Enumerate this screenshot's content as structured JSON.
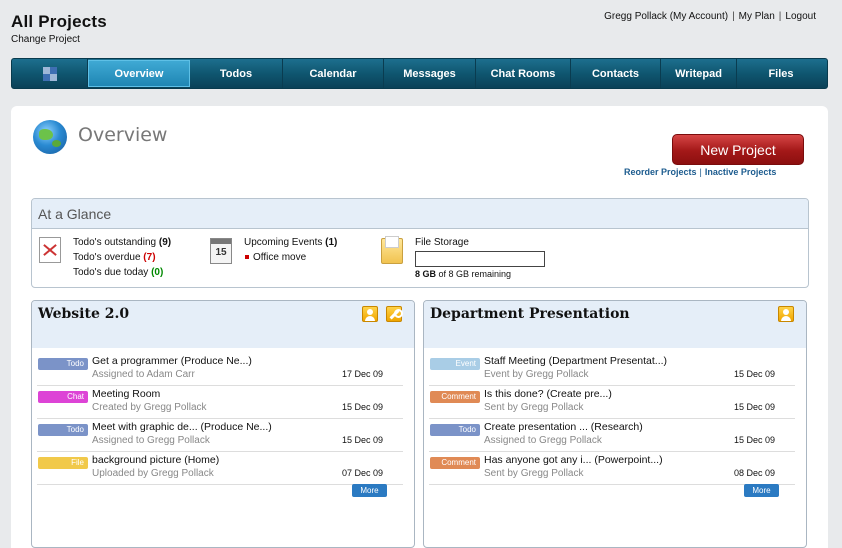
{
  "header": {
    "title": "All Projects",
    "change_project": "Change Project",
    "user_link": "Gregg Pollack (My Account)",
    "plan_link": "My Plan",
    "logout_link": "Logout",
    "separator": "|"
  },
  "nav": {
    "home_icon": "app-home-icon",
    "tabs": [
      "Overview",
      "Todos",
      "Calendar",
      "Messages",
      "Chat Rooms",
      "Contacts",
      "Writepad",
      "Files"
    ],
    "active_tab": "Overview"
  },
  "overview": {
    "icon": "globe-icon",
    "title": "Overview",
    "new_project_label": "New Project",
    "reorder_link": "Reorder Projects",
    "inactive_link": "Inactive Projects"
  },
  "glance": {
    "title": "At a Glance",
    "todos": {
      "outstanding_label": "Todo's outstanding",
      "outstanding_count": "(9)",
      "overdue_label": "Todo's overdue",
      "overdue_count": "(7)",
      "due_today_label": "Todo's due today",
      "due_today_count": "(0)"
    },
    "events": {
      "calendar_icon_text": "15",
      "label": "Upcoming Events",
      "count": "(1)",
      "item": "Office move"
    },
    "storage": {
      "label": "File Storage",
      "used": "8 GB",
      "rest": "of 8 GB remaining",
      "used_fraction": 0.0
    }
  },
  "projects": [
    {
      "title": "Website 2.0",
      "icons": [
        "person-icon",
        "wrench-icon"
      ],
      "more_label": "More",
      "items": [
        {
          "type": "Todo",
          "color": "#7b93c8",
          "title": "Get a programmer  (Produce Ne...)",
          "sub": "Assigned to Adam Carr",
          "date": "17 Dec 09"
        },
        {
          "type": "Chat",
          "color": "#dd44d6",
          "title": "Meeting Room",
          "sub": "Created by Gregg Pollack",
          "date": "15 Dec 09"
        },
        {
          "type": "Todo",
          "color": "#7b93c8",
          "title": "Meet with graphic de...  (Produce Ne...)",
          "sub": "Assigned to Gregg Pollack",
          "date": "15 Dec 09"
        },
        {
          "type": "File",
          "color": "#f1c94a",
          "title": "background picture (Home)",
          "sub": "Uploaded by Gregg Pollack",
          "date": "07 Dec 09"
        }
      ]
    },
    {
      "title": "Department Presentation",
      "icons": [
        "person-icon"
      ],
      "more_label": "More",
      "items": [
        {
          "type": "Event",
          "color": "#a9cde6",
          "title": "Staff Meeting (Department Presentat...)",
          "sub": "Event by Gregg Pollack",
          "date": "15 Dec 09"
        },
        {
          "type": "Comment",
          "color": "#e08a55",
          "title": "Is this done? (Create pre...)",
          "sub": "Sent by Gregg Pollack",
          "date": "15 Dec 09"
        },
        {
          "type": "Todo",
          "color": "#7b93c8",
          "title": "Create presentation ...  (Research)",
          "sub": "Assigned to Gregg Pollack",
          "date": "15 Dec 09"
        },
        {
          "type": "Comment",
          "color": "#e08a55",
          "title": "Has anyone got any i...  (Powerpoint...)",
          "sub": "Sent by Gregg Pollack",
          "date": "08 Dec 09"
        }
      ]
    }
  ]
}
